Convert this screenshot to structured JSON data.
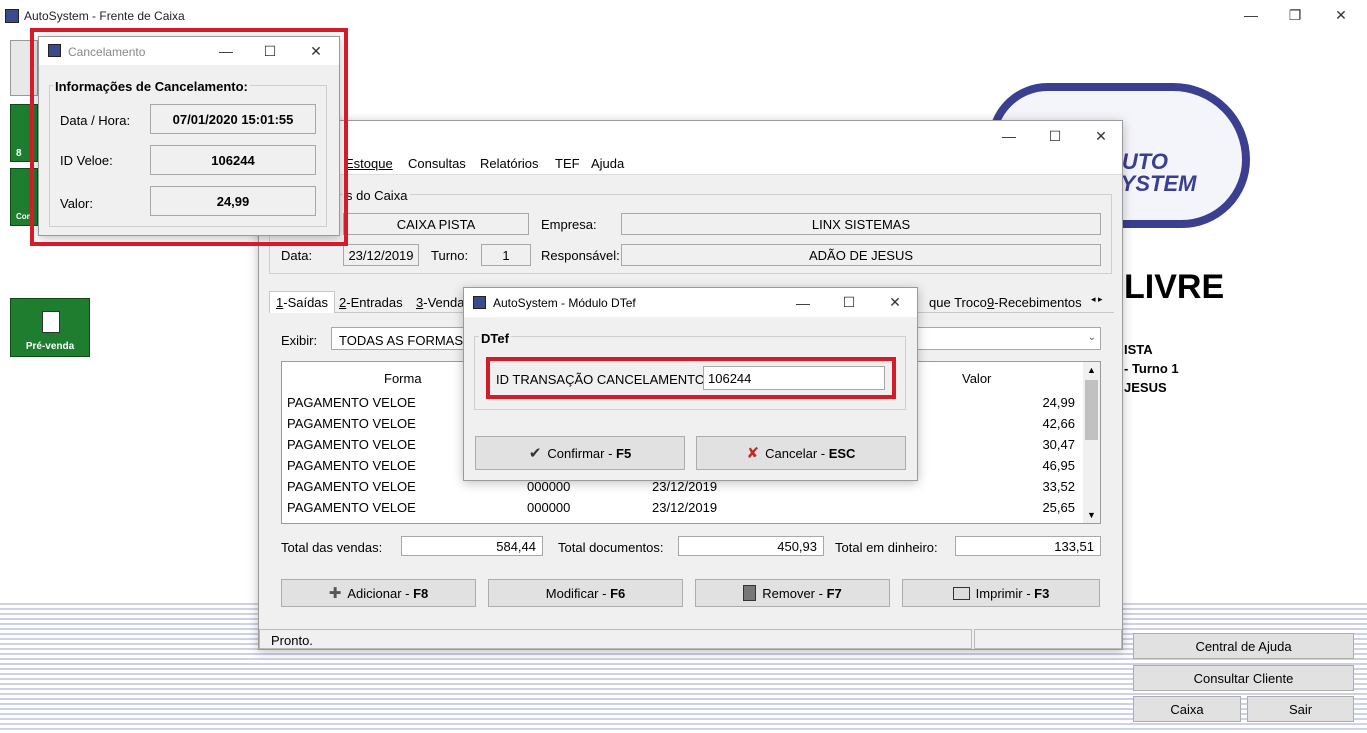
{
  "app": {
    "title": "AutoSystem - Frente de Caixa",
    "accent": "#d21c2a"
  },
  "background": {
    "logo_text": "AUTO SYSTEM",
    "status_big": "LIVRE",
    "info_line1": "ISTA",
    "info_line2": "- Turno 1",
    "info_line3": "JESUS"
  },
  "left_tiles": {
    "tile1_label": "8",
    "tile2_label": "Con",
    "prevenda_label": "Pré-venda"
  },
  "side_buttons": {
    "help": "Central de Ajuda",
    "client": "Consultar Cliente",
    "caixa": "Caixa",
    "sair": "Sair"
  },
  "main_window": {
    "menu": [
      "Estoque",
      "Consultas",
      "Relatórios",
      "TEF",
      "Ajuda"
    ],
    "group_title": "s do Caixa",
    "caixa_value": "CAIXA PISTA",
    "empresa_label": "Empresa:",
    "empresa_value": "LINX SISTEMAS",
    "data_label": "Data:",
    "data_value": "23/12/2019",
    "turno_label": "Turno:",
    "turno_value": "1",
    "responsavel_label": "Responsável:",
    "responsavel_value": "ADÃO DE JESUS",
    "tabs": {
      "t1_num": "1",
      "t1": "-Saídas",
      "t2_num": "2",
      "t2": "-Entradas",
      "t3_num": "3",
      "t3": "-Venda",
      "t4": "que Troco",
      "t5_num": "9",
      "t5": "-Recebimentos"
    },
    "exibir_label": "Exibir:",
    "exibir_value": "TODAS AS FORMAS D",
    "table_headers": {
      "forma": "Forma",
      "valor": "Valor"
    },
    "rows": [
      {
        "forma": "PAGAMENTO VELOE",
        "doc": "",
        "data": "",
        "valor": "24,99"
      },
      {
        "forma": "PAGAMENTO VELOE",
        "doc": "",
        "data": "",
        "valor": "42,66"
      },
      {
        "forma": "PAGAMENTO VELOE",
        "doc": "",
        "data": "",
        "valor": "30,47"
      },
      {
        "forma": "PAGAMENTO VELOE",
        "doc": "",
        "data": "",
        "valor": "46,95"
      },
      {
        "forma": "PAGAMENTO VELOE",
        "doc": "000000",
        "data": "23/12/2019",
        "valor": "33,52"
      },
      {
        "forma": "PAGAMENTO VELOE",
        "doc": "000000",
        "data": "23/12/2019",
        "valor": "25,65"
      }
    ],
    "totals": {
      "vendas_label": "Total das vendas:",
      "vendas_value": "584,44",
      "documentos_label": "Total documentos:",
      "documentos_value": "450,93",
      "dinheiro_label": "Total em dinheiro:",
      "dinheiro_value": "133,51"
    },
    "buttons": {
      "adicionar": "Adicionar - ",
      "adicionar_key": "F8",
      "modificar": "Modificar - ",
      "modificar_key": "F6",
      "remover": "Remover - ",
      "remover_key": "F7",
      "imprimir": "Imprimir - ",
      "imprimir_key": "F3"
    },
    "status": "Pronto."
  },
  "cancel_window": {
    "title": "Cancelamento",
    "group_title": "Informações de Cancelamento:",
    "data_hora_label": "Data / Hora:",
    "data_hora_value": "07/01/2020 15:01:55",
    "id_label": "ID Veloe:",
    "id_value": "106244",
    "valor_label": "Valor:",
    "valor_value": "24,99"
  },
  "dtef_window": {
    "title": "AutoSystem - Módulo DTef",
    "group_title": "DTef",
    "field_label": "ID TRANSAÇÃO CANCELAMENTO:",
    "field_value": "106244",
    "confirm": "Confirmar - ",
    "confirm_key": "F5",
    "cancel": "Cancelar - ",
    "cancel_key": "ESC"
  }
}
